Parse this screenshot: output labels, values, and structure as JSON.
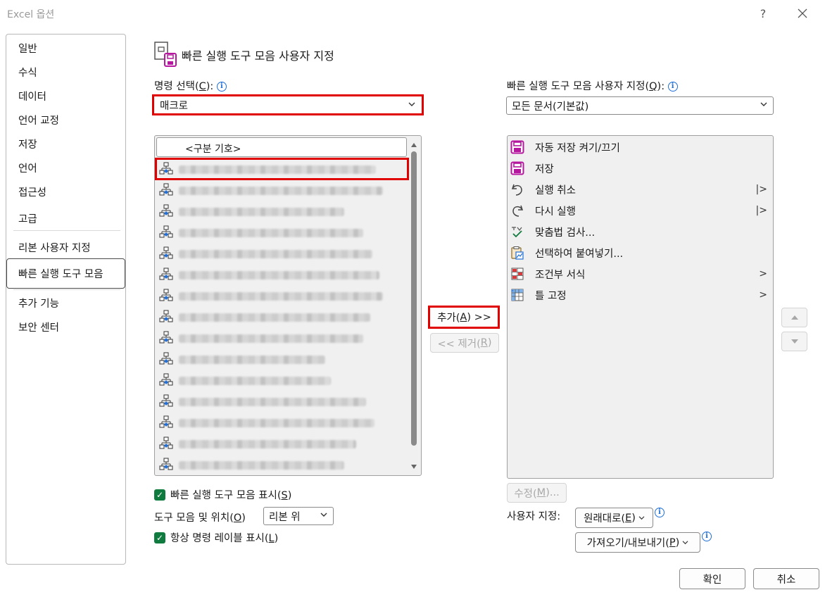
{
  "window": {
    "title": "Excel 옵션",
    "help": "?",
    "close": "✕"
  },
  "sidebar": {
    "items": [
      {
        "label": "일반"
      },
      {
        "label": "수식"
      },
      {
        "label": "데이터"
      },
      {
        "label": "언어 교정"
      },
      {
        "label": "저장"
      },
      {
        "label": "언어"
      },
      {
        "label": "접근성"
      },
      {
        "label": "고급"
      },
      {
        "label": "리본 사용자 지정"
      },
      {
        "label": "빠른 실행 도구 모음"
      },
      {
        "label": "추가 기능"
      },
      {
        "label": "보안 센터"
      }
    ],
    "selected": "빠른 실행 도구 모음"
  },
  "header": {
    "title": "빠른 실행 도구 모음 사용자 지정"
  },
  "left": {
    "choose_label": "명령 선택(",
    "choose_key": "C",
    "choose_tail": "):",
    "choose_value": "매크로",
    "separator": "<구분 기호>",
    "macro_count": 15
  },
  "right": {
    "customize_label": "빠른 실행 도구 모음 사용자 지정(",
    "customize_key": "Q",
    "customize_tail": "):",
    "customize_value": "모든 문서(기본값)",
    "items": [
      {
        "label": "자동 저장 켜기/끄기",
        "icon": "save-purple-icon"
      },
      {
        "label": "저장",
        "icon": "save-purple-icon"
      },
      {
        "label": "실행 취소",
        "icon": "undo-icon",
        "arrow": "|>"
      },
      {
        "label": "다시 실행",
        "icon": "redo-icon",
        "arrow": "|>"
      },
      {
        "label": "맞춤법 검사...",
        "icon": "spellcheck-icon"
      },
      {
        "label": "선택하여 붙여넣기...",
        "icon": "paste-special-icon"
      },
      {
        "label": "조건부 서식",
        "icon": "conditional-format-icon",
        "arrow": ">"
      },
      {
        "label": "틀 고정",
        "icon": "freeze-panes-icon",
        "arrow": ">"
      }
    ]
  },
  "middle": {
    "add_label": "추가(",
    "add_key": "A",
    "add_tail": ") >>",
    "remove_label": "<< 제거(",
    "remove_key": "R",
    "remove_tail": ")"
  },
  "bottom_left": {
    "show_toolbar": "빠른 실행 도구 모음 표시(",
    "show_toolbar_key": "S",
    "show_toolbar_tail": ")",
    "position_label": "도구 모음 및 위치(",
    "position_key": "O",
    "position_tail": ")",
    "position_value": "리본 위",
    "always_labels": "항상 명령 레이블 표시(",
    "always_labels_key": "L",
    "always_labels_tail": ")"
  },
  "bottom_right": {
    "modify_label": "수정(",
    "modify_key": "M",
    "modify_tail": ")...",
    "customize_label": "사용자 지정:",
    "reset_label": "원래대로(",
    "reset_key": "E",
    "reset_tail": ")",
    "import_export_label": "가져오기/내보내기(",
    "import_export_key": "P",
    "import_export_tail": ")"
  },
  "footer": {
    "ok": "확인",
    "cancel": "취소"
  },
  "colors": {
    "highlight": "#e00000",
    "check": "#0f7b3e",
    "info": "#1f6fd6",
    "save_icon": "#b5179e"
  }
}
